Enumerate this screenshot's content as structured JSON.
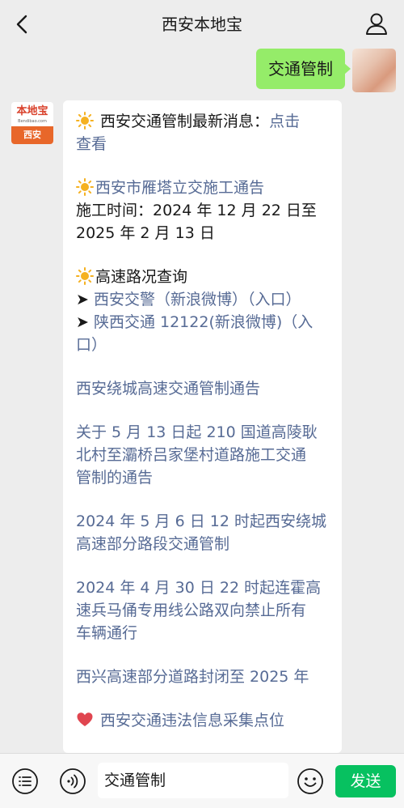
{
  "header": {
    "title": "西安本地宝"
  },
  "user_message": {
    "text": "交通管制"
  },
  "bot_avatar": {
    "logo_text": "本地宝",
    "logo_url": "Bendibao.com",
    "city": "西安"
  },
  "bot_message": {
    "lines": [
      "西安交通管制最新消息：",
      "点击",
      "查看",
      "西安市雁塔立交施工通告",
      "施工时间：2024 年 12 月 22 日至",
      "2025 年 2 月 13 日",
      "高速路况查询",
      "➤",
      "西安交警（新浪微博）",
      "（入口）",
      "➤",
      "陕西交通 12122(新浪微博)（入",
      "口）",
      "西安绕城高速交通管制通告",
      "关于 5 月 13 日起 210 国道高陵耿",
      "北村至灞桥吕家堡村道路施工交通",
      "管制的通告",
      "2024 年 5 月 6 日 12 时起西安绕城",
      "高速部分路段交通管制",
      "2024 年 4 月 30 日 22 时起连霍高",
      "速兵马俑专用线公路双向禁止所有",
      "车辆通行",
      "西兴高速部分道路封闭至 2025 年",
      "西安交通违法信息采集点位"
    ]
  },
  "input_bar": {
    "value": "交通管制",
    "send_label": "发送"
  },
  "colors": {
    "background": "#ededed",
    "user_bubble": "#95ec69",
    "link": "#576b95",
    "send_button": "#07c160",
    "heart": "#e0454f",
    "sun": "#f5b120"
  },
  "icons": {
    "back": "chevron-left-icon",
    "profile": "person-icon",
    "sun": "sun-icon",
    "heart": "heart-icon",
    "menu": "list-menu-icon",
    "voice": "voice-icon",
    "emoji": "emoji-icon"
  }
}
